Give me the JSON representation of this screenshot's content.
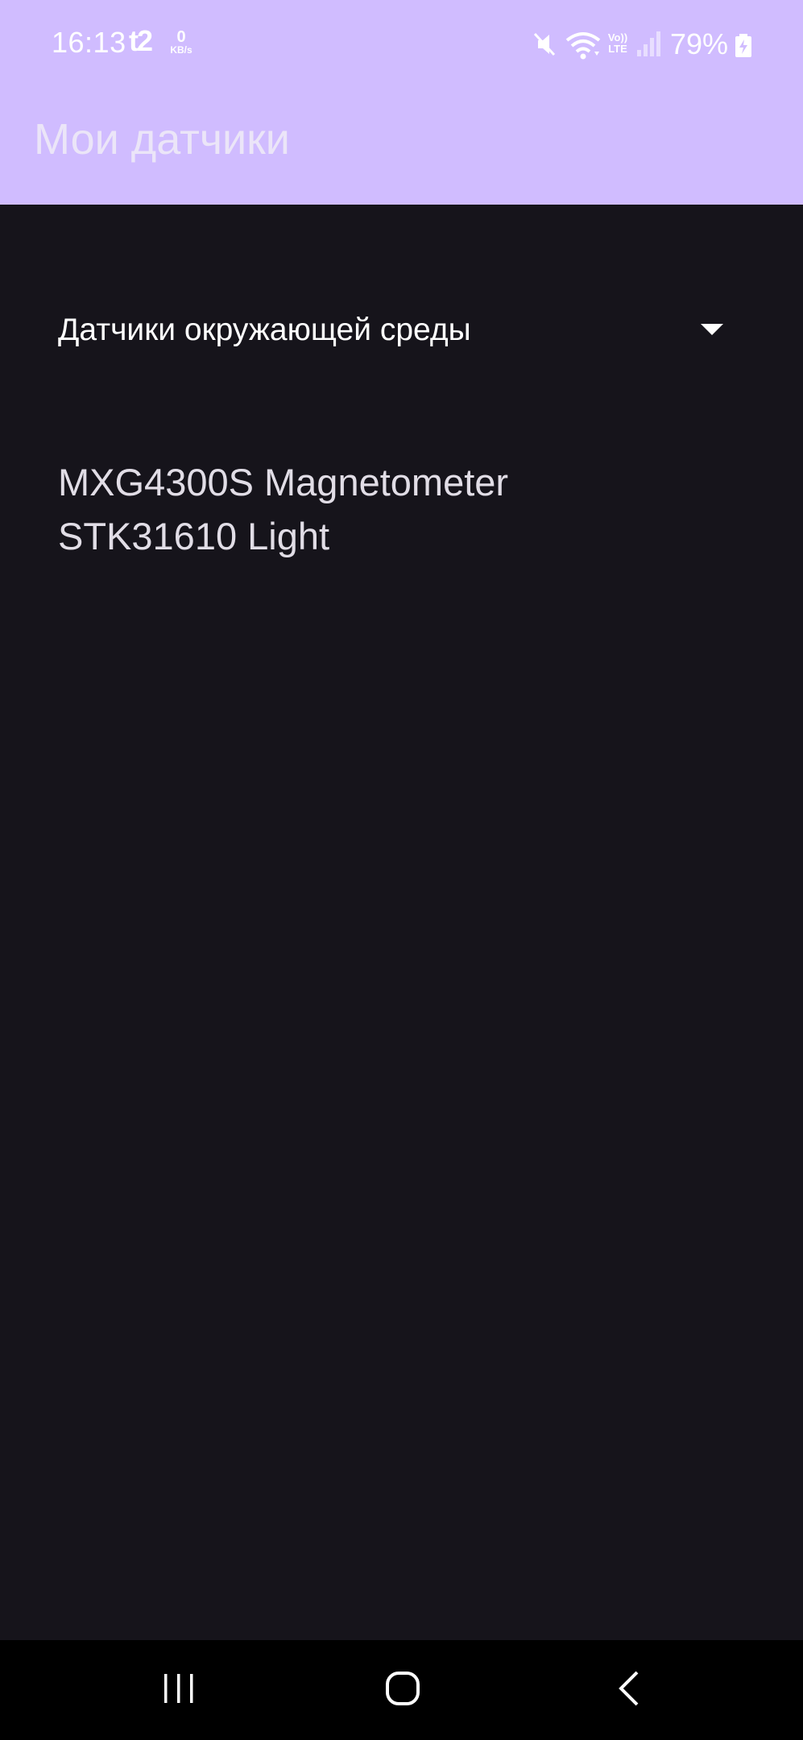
{
  "status_bar": {
    "time": "16:13",
    "carrier": "t2",
    "speed_value": "0",
    "speed_unit": "KB/s",
    "volte_top": "Vo))",
    "volte_bottom": "LTE",
    "battery": "79%",
    "icons": [
      "mute-icon",
      "wifi-icon",
      "signal-icon",
      "battery-charging-icon"
    ]
  },
  "app_bar": {
    "title": "Мои датчики"
  },
  "category_dropdown": {
    "selected": "Датчики окружающей среды"
  },
  "sensors": [
    "MXG4300S Magnetometer",
    "STK31610 Light"
  ],
  "navigation": {
    "icons": [
      "recent-apps-icon",
      "home-icon",
      "back-icon"
    ]
  },
  "colors": {
    "header_bg": "#d0bcff",
    "body_bg": "#16141b",
    "nav_bg": "#000000"
  }
}
